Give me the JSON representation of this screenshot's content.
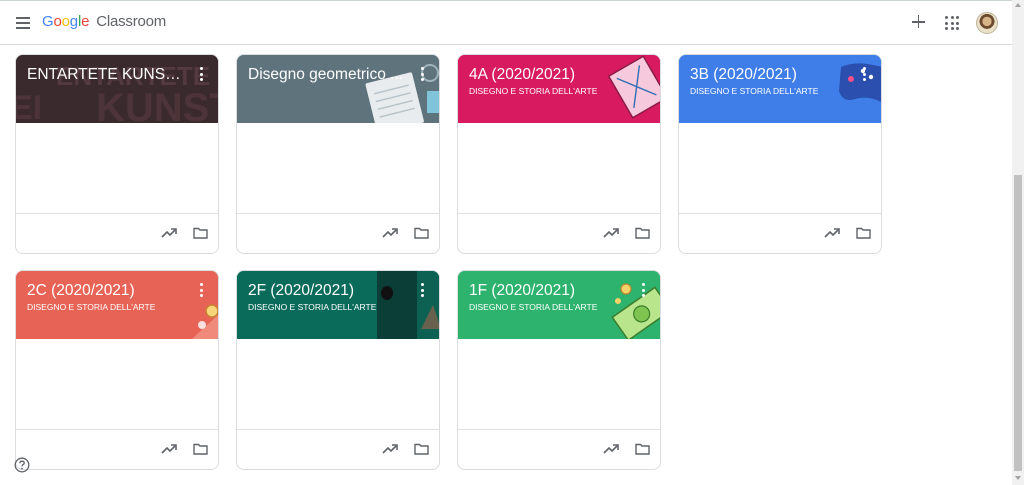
{
  "app": {
    "logo_google": "Google",
    "logo_product": "Classroom"
  },
  "icons": {
    "menu": "menu-icon",
    "add": "plus-icon",
    "apps": "apps-grid-icon",
    "profile": "avatar",
    "trend": "trending-up-icon",
    "folder": "folder-icon",
    "help": "help-icon"
  },
  "courses": [
    {
      "title": "ENTARTETE KUNST - ...",
      "subtitle": "",
      "color": "#3a2a2e"
    },
    {
      "title": "Disegno geometrico ...",
      "subtitle": "",
      "color": "#5e737c"
    },
    {
      "title": "4A (2020/2021)",
      "subtitle": "DISEGNO E STORIA DELL'ARTE",
      "color": "#d81b60"
    },
    {
      "title": "3B (2020/2021)",
      "subtitle": "DISEGNO E STORIA DELL'ARTE",
      "color": "#3f7ee8"
    },
    {
      "title": "2C (2020/2021)",
      "subtitle": "DISEGNO E STORIA DELL'ARTE",
      "color": "#e66355"
    },
    {
      "title": "2F (2020/2021)",
      "subtitle": "DISEGNO E STORIA DELL'ARTE",
      "color": "#0b6b5a"
    },
    {
      "title": "1F (2020/2021)",
      "subtitle": "DISEGNO E STORIA DELL'ARTE",
      "color": "#2eb36f"
    }
  ]
}
